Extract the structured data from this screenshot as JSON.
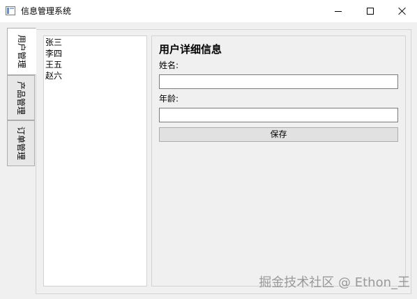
{
  "window": {
    "title": "信息管理系统",
    "icon": "app-window-icon",
    "controls": [
      "minimize-icon",
      "maximize-icon",
      "close-icon"
    ]
  },
  "tabs": [
    {
      "label": "用户管理",
      "active": true
    },
    {
      "label": "产品管理",
      "active": false
    },
    {
      "label": "订单管理",
      "active": false
    }
  ],
  "user_list": [
    "张三",
    "李四",
    "王五",
    "赵六"
  ],
  "detail": {
    "title": "用户详细信息",
    "name_label": "姓名:",
    "name_value": "",
    "age_label": "年龄:",
    "age_value": "",
    "save_label": "保存"
  },
  "watermark": "掘金技术社区 @ Ethon_王",
  "colors": {
    "window_bg": "#f0f0f0",
    "titlebar_bg": "#ffffff",
    "border": "#adadad",
    "button_bg": "#e1e1e1",
    "watermark": "#8a8a8a"
  }
}
